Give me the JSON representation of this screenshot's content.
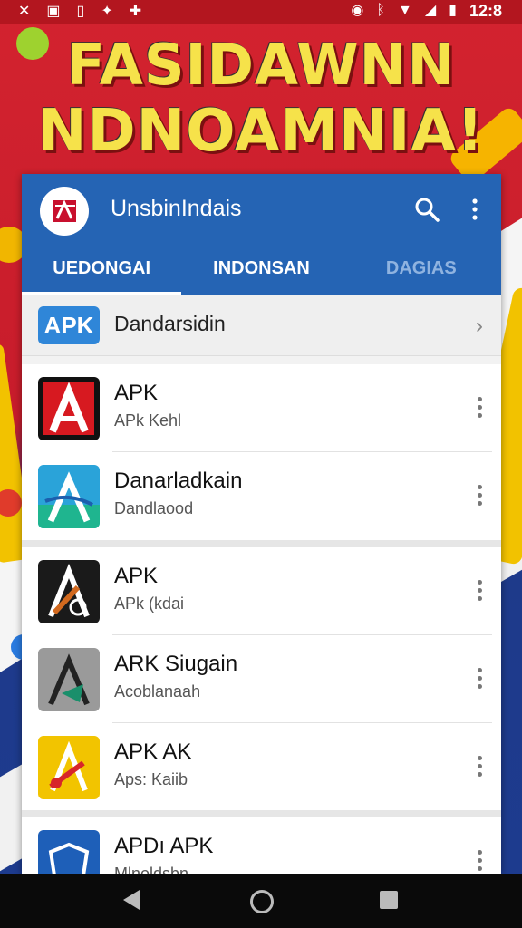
{
  "status_bar": {
    "time": "12:8",
    "left_icons": [
      "cast-icon",
      "image-icon",
      "sd-card-icon",
      "notification-icon",
      "game-icon"
    ],
    "right_icons": [
      "alarm-icon",
      "bluetooth-icon",
      "wifi-icon",
      "signal-icon",
      "battery-icon"
    ]
  },
  "banner": {
    "line1": "FASIDAWNN",
    "line2": "NDNOAMNIA!"
  },
  "appbar": {
    "title": "UnsbinIndais",
    "tabs": [
      {
        "label": "UEDONGAI",
        "active": true
      },
      {
        "label": "INDONSAN",
        "active": false
      },
      {
        "label": "DAGIAS",
        "active": false
      }
    ]
  },
  "header_row": {
    "badge": "APK",
    "label": "Dandarsidin"
  },
  "items": [
    {
      "title": "APK",
      "subtitle": "APk Kehl"
    },
    {
      "title": "Danarladkain",
      "subtitle": "Dandlaood"
    },
    {
      "title": "APK",
      "subtitle": "APk (kdai"
    },
    {
      "title": "ARK Siugain",
      "subtitle": "Acoblanaah"
    },
    {
      "title": "APK AK",
      "subtitle": "Aps: Kaiib"
    },
    {
      "title": "APDı APK",
      "subtitle": "Mlnoldsbn"
    }
  ],
  "colors": {
    "appbar": "#2564b4",
    "badge": "#2f86d8",
    "banner_text": "#f6e24a"
  }
}
